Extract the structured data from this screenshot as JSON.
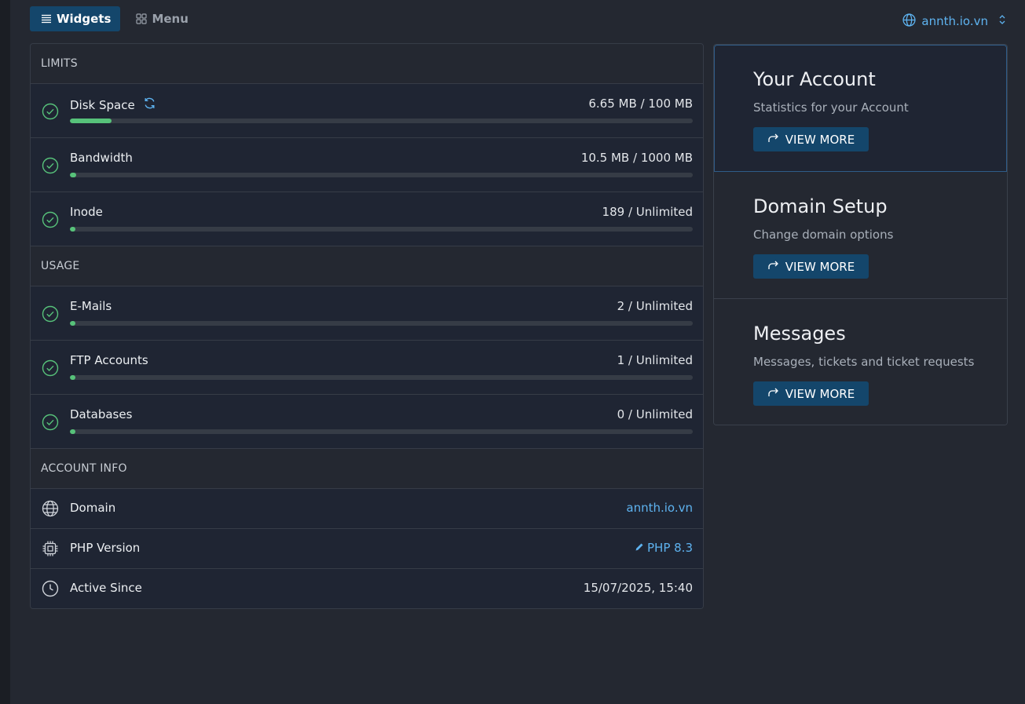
{
  "nav": {
    "tabs": [
      {
        "label": "Widgets",
        "icon": "list-icon",
        "active": true
      },
      {
        "label": "Menu",
        "icon": "grid-icon",
        "active": false
      }
    ],
    "domain_selector": "annth.io.vn"
  },
  "limits": {
    "heading": "LIMITS",
    "items": [
      {
        "label": "Disk Space",
        "value": "6.65 MB / 100 MB",
        "progress": 0.0665,
        "refresh_icon": true
      },
      {
        "label": "Bandwidth",
        "value": "10.5 MB / 1000 MB",
        "progress": 0.0105
      },
      {
        "label": "Inode",
        "value": "189 / Unlimited",
        "progress": 0
      }
    ]
  },
  "usage": {
    "heading": "USAGE",
    "items": [
      {
        "label": "E-Mails",
        "value": "2 / Unlimited",
        "progress": 0
      },
      {
        "label": "FTP Accounts",
        "value": "1 / Unlimited",
        "progress": 0
      },
      {
        "label": "Databases",
        "value": "0 / Unlimited",
        "progress": 0
      }
    ]
  },
  "account_info": {
    "heading": "ACCOUNT INFO",
    "domain": {
      "label": "Domain",
      "value": "annth.io.vn"
    },
    "php": {
      "label": "PHP Version",
      "value": "PHP 8.3"
    },
    "active_since": {
      "label": "Active Since",
      "value": "15/07/2025, 15:40"
    }
  },
  "cards": [
    {
      "title": "Your Account",
      "description": "Statistics for your Account",
      "button": "VIEW MORE"
    },
    {
      "title": "Domain Setup",
      "description": "Change domain options",
      "button": "VIEW MORE"
    },
    {
      "title": "Messages",
      "description": "Messages, tickets and ticket requests",
      "button": "VIEW MORE"
    }
  ],
  "colors": {
    "accent": "#14466b",
    "link": "#5eb3f0",
    "success": "#57c27a",
    "background": "#242831",
    "row_background": "#1f2533"
  }
}
